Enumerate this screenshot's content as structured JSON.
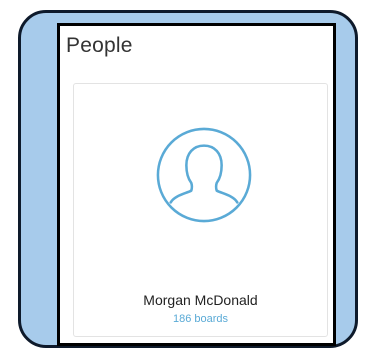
{
  "page": {
    "title": "People"
  },
  "person": {
    "name": "Morgan McDonald",
    "boards": "186 boards",
    "avatar_icon": "user-avatar-icon",
    "accent_color": "#5aaad6"
  },
  "colors": {
    "frame_fill": "#a7cbeb",
    "frame_border": "#0e1a2b"
  }
}
